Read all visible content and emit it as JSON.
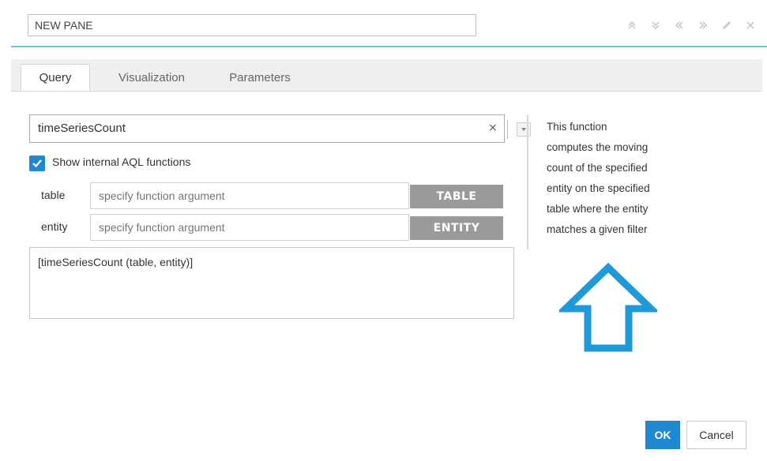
{
  "title": "NEW PANE",
  "tabs": [
    {
      "label": "Query",
      "active": true
    },
    {
      "label": "Visualization",
      "active": false
    },
    {
      "label": "Parameters",
      "active": false
    }
  ],
  "function_select": {
    "value": "timeSeriesCount",
    "clear_glyph": "×"
  },
  "show_internal": {
    "checked": true,
    "label": "Show internal AQL functions"
  },
  "arguments": [
    {
      "label": "table",
      "placeholder": "specify function argument",
      "button": "TABLE"
    },
    {
      "label": "entity",
      "placeholder": "specify function argument",
      "button": "ENTITY"
    }
  ],
  "expression": "[timeSeriesCount (table, entity)]",
  "description": [
    "This function",
    "computes the moving",
    "count of the specified",
    "entity on the specified",
    "table where the entity",
    "matches a given filter"
  ],
  "icons": [
    "move-top-icon",
    "move-bottom-icon",
    "move-left-icon",
    "move-right-icon",
    "edit-icon",
    "close-icon"
  ],
  "buttons": {
    "ok": "OK",
    "cancel": "Cancel"
  },
  "colors": {
    "accent": "#1e88d0",
    "rule": "#6cc3e3",
    "arg_button": "#9a9a9a"
  }
}
